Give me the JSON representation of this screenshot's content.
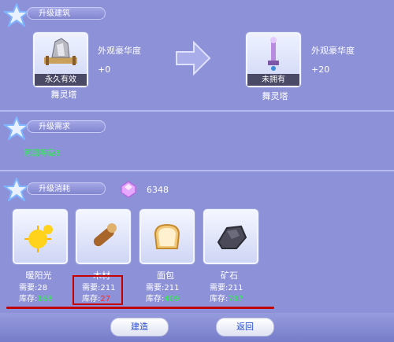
{
  "sections": {
    "upgrade_building": "升级建筑",
    "upgrade_requirement": "升级需求",
    "upgrade_cost": "升级消耗"
  },
  "current": {
    "status": "永久有效",
    "name": "舞灵塔",
    "attr_label": "外观豪华度",
    "attr_value": "+0"
  },
  "next": {
    "status": "未拥有",
    "name": "舞灵塔",
    "attr_label": "外观豪华度",
    "attr_value": "+20"
  },
  "requirement": "家园等级8",
  "crystal": {
    "amount": "6348"
  },
  "resources": [
    {
      "name": "暖阳光",
      "need_label": "需要:",
      "need": "28",
      "stock_label": "库存:",
      "stock": "168"
    },
    {
      "name": "木材",
      "need_label": "需要:",
      "need": "211",
      "stock_label": "库存:",
      "stock": "27"
    },
    {
      "name": "面包",
      "need_label": "需要:",
      "need": "211",
      "stock_label": "库存:",
      "stock": "409"
    },
    {
      "name": "矿石",
      "need_label": "需要:",
      "need": "211",
      "stock_label": "库存:",
      "stock": "787"
    }
  ],
  "buttons": {
    "build": "建造",
    "back": "返回"
  }
}
